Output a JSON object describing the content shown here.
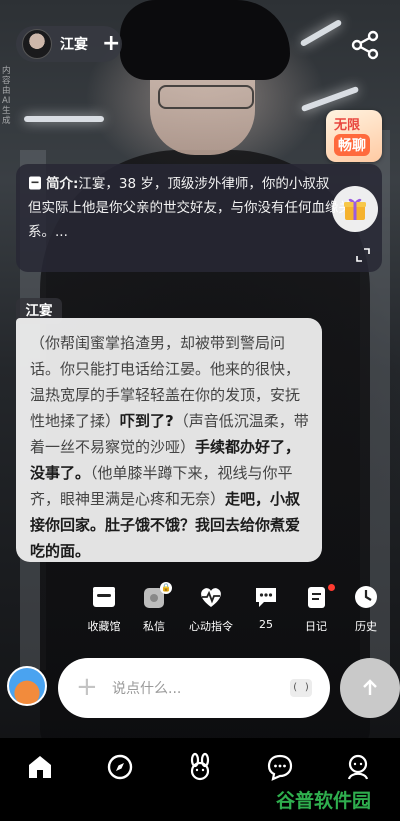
{
  "header": {
    "character_name": "江宴",
    "follow_symbol": "+",
    "ai_note": "内容由AI生成"
  },
  "promo": {
    "line1": "无限",
    "line2": "畅聊"
  },
  "intro": {
    "label": "简介:",
    "text": "江宴，38 岁，顶级涉外律师，你的小叔叔\n但实际上他是你父亲的世交好友，与你没有任何血缘关系。..."
  },
  "chat": {
    "speaker": "江宴",
    "segments": [
      {
        "text": "（你帮闺蜜掌掐渣男，却被带到警局问话。你只能打电话给江晏。他来的很快，温热宽厚的手掌轻轻盖在你的发顶，安抚性地揉了揉）",
        "strong": false
      },
      {
        "text": "吓到了?",
        "strong": true
      },
      {
        "text": "（声音低沉温柔，带着一丝不易察觉的沙哑）",
        "strong": false
      },
      {
        "text": "手续都办好了，没事了。",
        "strong": true
      },
      {
        "text": "（他单膝半蹲下来，视线与你平齐，眼神里满是心疼和无奈）",
        "strong": false
      },
      {
        "text": "走吧，小叔接你回家。肚子饿不饿？我回去给你煮爱吃的面。",
        "strong": true
      }
    ]
  },
  "quick_actions": [
    {
      "label": "收藏馆",
      "icon": "collection-box-icon"
    },
    {
      "label": "私信",
      "icon": "private-message-icon"
    },
    {
      "label": "心动指令",
      "icon": "heartbeat-icon"
    },
    {
      "label": "25",
      "icon": "chat-count-icon"
    },
    {
      "label": "日记",
      "icon": "diary-icon"
    },
    {
      "label": "历史",
      "icon": "history-clock-icon"
    }
  ],
  "input": {
    "placeholder": "说点什么...",
    "voice_label": "( )"
  },
  "bottom_nav": [
    {
      "icon": "home-icon"
    },
    {
      "icon": "discover-compass-icon"
    },
    {
      "icon": "character-bunny-icon"
    },
    {
      "icon": "messages-icon"
    },
    {
      "icon": "profile-icon"
    }
  ],
  "watermark": "谷普软件园"
}
